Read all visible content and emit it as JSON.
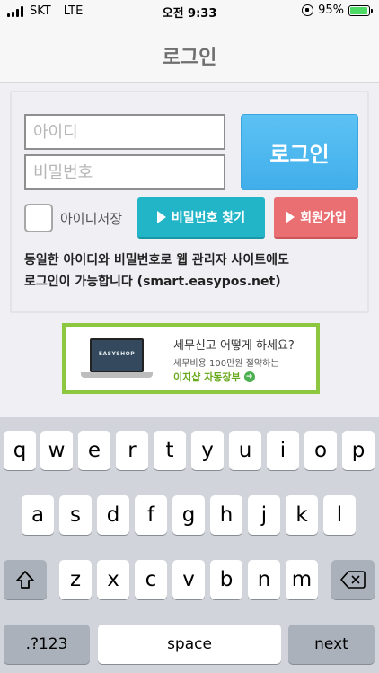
{
  "status": {
    "carrier": "SKT",
    "network": "LTE",
    "time": "오전 9:33",
    "battery": "95%",
    "battery_level": 0.95
  },
  "header": {
    "title": "로그인"
  },
  "login": {
    "id_placeholder": "아이디",
    "pw_placeholder": "비밀번호",
    "login_button": "로그인",
    "remember_label": "아이디저장",
    "find_pw_button": "비밀번호 찾기",
    "join_button": "회원가입",
    "notice_line1": "동일한 아이디와 비밀번호로 웹 관리자 사이트에도",
    "notice_line2": "로그인이 가능합니다 (smart.easypos.net)"
  },
  "banner": {
    "laptop_text": "EASYSHOP",
    "title": "세무신고 어떻게 하세요?",
    "subtitle": "세무비용 100만원 절약하는",
    "cta": "이지샵 자동장부",
    "border_color": "#8dc63f"
  },
  "keyboard": {
    "row1": [
      "q",
      "w",
      "e",
      "r",
      "t",
      "y",
      "u",
      "i",
      "o",
      "p"
    ],
    "row2": [
      "a",
      "s",
      "d",
      "f",
      "g",
      "h",
      "j",
      "k",
      "l"
    ],
    "row3": [
      "z",
      "x",
      "c",
      "v",
      "b",
      "n",
      "m"
    ],
    "shift_icon": "shift-icon",
    "delete_icon": "delete-icon",
    "numbers_label": ".?123",
    "space_label": "space",
    "next_label": "next"
  },
  "colors": {
    "login_button": "#41aeea",
    "find_button": "#22b5c7",
    "join_button": "#ea6f73"
  }
}
